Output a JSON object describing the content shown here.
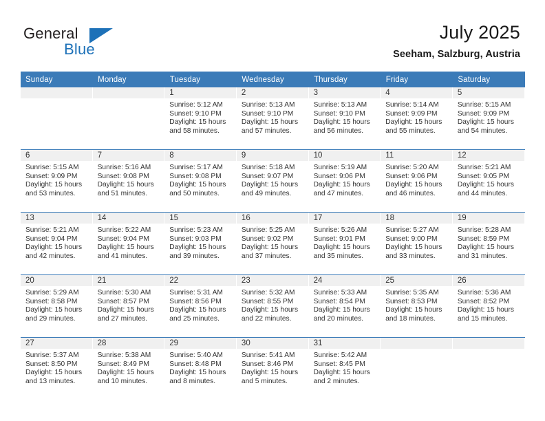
{
  "brand": {
    "name_top": "General",
    "name_bottom": "Blue",
    "triangle_color": "#1d71b8"
  },
  "header": {
    "title": "July 2025",
    "subtitle": "Seeham, Salzburg, Austria"
  },
  "theme": {
    "header_blue": "#3b7bb8",
    "band_gray": "#f0f0f0",
    "text": "#333333"
  },
  "weekday_headers": [
    "Sunday",
    "Monday",
    "Tuesday",
    "Wednesday",
    "Thursday",
    "Friday",
    "Saturday"
  ],
  "labels": {
    "sunrise_prefix": "Sunrise:",
    "sunset_prefix": "Sunset:",
    "daylight_prefix": "Daylight:"
  },
  "weeks": [
    [
      {
        "day": "",
        "blank": true
      },
      {
        "day": "",
        "blank": true
      },
      {
        "day": "1",
        "sunrise": "Sunrise: 5:12 AM",
        "sunset": "Sunset: 9:10 PM",
        "daylight1": "Daylight: 15 hours",
        "daylight2": "and 58 minutes."
      },
      {
        "day": "2",
        "sunrise": "Sunrise: 5:13 AM",
        "sunset": "Sunset: 9:10 PM",
        "daylight1": "Daylight: 15 hours",
        "daylight2": "and 57 minutes."
      },
      {
        "day": "3",
        "sunrise": "Sunrise: 5:13 AM",
        "sunset": "Sunset: 9:10 PM",
        "daylight1": "Daylight: 15 hours",
        "daylight2": "and 56 minutes."
      },
      {
        "day": "4",
        "sunrise": "Sunrise: 5:14 AM",
        "sunset": "Sunset: 9:09 PM",
        "daylight1": "Daylight: 15 hours",
        "daylight2": "and 55 minutes."
      },
      {
        "day": "5",
        "sunrise": "Sunrise: 5:15 AM",
        "sunset": "Sunset: 9:09 PM",
        "daylight1": "Daylight: 15 hours",
        "daylight2": "and 54 minutes."
      }
    ],
    [
      {
        "day": "6",
        "sunrise": "Sunrise: 5:15 AM",
        "sunset": "Sunset: 9:09 PM",
        "daylight1": "Daylight: 15 hours",
        "daylight2": "and 53 minutes."
      },
      {
        "day": "7",
        "sunrise": "Sunrise: 5:16 AM",
        "sunset": "Sunset: 9:08 PM",
        "daylight1": "Daylight: 15 hours",
        "daylight2": "and 51 minutes."
      },
      {
        "day": "8",
        "sunrise": "Sunrise: 5:17 AM",
        "sunset": "Sunset: 9:08 PM",
        "daylight1": "Daylight: 15 hours",
        "daylight2": "and 50 minutes."
      },
      {
        "day": "9",
        "sunrise": "Sunrise: 5:18 AM",
        "sunset": "Sunset: 9:07 PM",
        "daylight1": "Daylight: 15 hours",
        "daylight2": "and 49 minutes."
      },
      {
        "day": "10",
        "sunrise": "Sunrise: 5:19 AM",
        "sunset": "Sunset: 9:06 PM",
        "daylight1": "Daylight: 15 hours",
        "daylight2": "and 47 minutes."
      },
      {
        "day": "11",
        "sunrise": "Sunrise: 5:20 AM",
        "sunset": "Sunset: 9:06 PM",
        "daylight1": "Daylight: 15 hours",
        "daylight2": "and 46 minutes."
      },
      {
        "day": "12",
        "sunrise": "Sunrise: 5:21 AM",
        "sunset": "Sunset: 9:05 PM",
        "daylight1": "Daylight: 15 hours",
        "daylight2": "and 44 minutes."
      }
    ],
    [
      {
        "day": "13",
        "sunrise": "Sunrise: 5:21 AM",
        "sunset": "Sunset: 9:04 PM",
        "daylight1": "Daylight: 15 hours",
        "daylight2": "and 42 minutes."
      },
      {
        "day": "14",
        "sunrise": "Sunrise: 5:22 AM",
        "sunset": "Sunset: 9:04 PM",
        "daylight1": "Daylight: 15 hours",
        "daylight2": "and 41 minutes."
      },
      {
        "day": "15",
        "sunrise": "Sunrise: 5:23 AM",
        "sunset": "Sunset: 9:03 PM",
        "daylight1": "Daylight: 15 hours",
        "daylight2": "and 39 minutes."
      },
      {
        "day": "16",
        "sunrise": "Sunrise: 5:25 AM",
        "sunset": "Sunset: 9:02 PM",
        "daylight1": "Daylight: 15 hours",
        "daylight2": "and 37 minutes."
      },
      {
        "day": "17",
        "sunrise": "Sunrise: 5:26 AM",
        "sunset": "Sunset: 9:01 PM",
        "daylight1": "Daylight: 15 hours",
        "daylight2": "and 35 minutes."
      },
      {
        "day": "18",
        "sunrise": "Sunrise: 5:27 AM",
        "sunset": "Sunset: 9:00 PM",
        "daylight1": "Daylight: 15 hours",
        "daylight2": "and 33 minutes."
      },
      {
        "day": "19",
        "sunrise": "Sunrise: 5:28 AM",
        "sunset": "Sunset: 8:59 PM",
        "daylight1": "Daylight: 15 hours",
        "daylight2": "and 31 minutes."
      }
    ],
    [
      {
        "day": "20",
        "sunrise": "Sunrise: 5:29 AM",
        "sunset": "Sunset: 8:58 PM",
        "daylight1": "Daylight: 15 hours",
        "daylight2": "and 29 minutes."
      },
      {
        "day": "21",
        "sunrise": "Sunrise: 5:30 AM",
        "sunset": "Sunset: 8:57 PM",
        "daylight1": "Daylight: 15 hours",
        "daylight2": "and 27 minutes."
      },
      {
        "day": "22",
        "sunrise": "Sunrise: 5:31 AM",
        "sunset": "Sunset: 8:56 PM",
        "daylight1": "Daylight: 15 hours",
        "daylight2": "and 25 minutes."
      },
      {
        "day": "23",
        "sunrise": "Sunrise: 5:32 AM",
        "sunset": "Sunset: 8:55 PM",
        "daylight1": "Daylight: 15 hours",
        "daylight2": "and 22 minutes."
      },
      {
        "day": "24",
        "sunrise": "Sunrise: 5:33 AM",
        "sunset": "Sunset: 8:54 PM",
        "daylight1": "Daylight: 15 hours",
        "daylight2": "and 20 minutes."
      },
      {
        "day": "25",
        "sunrise": "Sunrise: 5:35 AM",
        "sunset": "Sunset: 8:53 PM",
        "daylight1": "Daylight: 15 hours",
        "daylight2": "and 18 minutes."
      },
      {
        "day": "26",
        "sunrise": "Sunrise: 5:36 AM",
        "sunset": "Sunset: 8:52 PM",
        "daylight1": "Daylight: 15 hours",
        "daylight2": "and 15 minutes."
      }
    ],
    [
      {
        "day": "27",
        "sunrise": "Sunrise: 5:37 AM",
        "sunset": "Sunset: 8:50 PM",
        "daylight1": "Daylight: 15 hours",
        "daylight2": "and 13 minutes."
      },
      {
        "day": "28",
        "sunrise": "Sunrise: 5:38 AM",
        "sunset": "Sunset: 8:49 PM",
        "daylight1": "Daylight: 15 hours",
        "daylight2": "and 10 minutes."
      },
      {
        "day": "29",
        "sunrise": "Sunrise: 5:40 AM",
        "sunset": "Sunset: 8:48 PM",
        "daylight1": "Daylight: 15 hours",
        "daylight2": "and 8 minutes."
      },
      {
        "day": "30",
        "sunrise": "Sunrise: 5:41 AM",
        "sunset": "Sunset: 8:46 PM",
        "daylight1": "Daylight: 15 hours",
        "daylight2": "and 5 minutes."
      },
      {
        "day": "31",
        "sunrise": "Sunrise: 5:42 AM",
        "sunset": "Sunset: 8:45 PM",
        "daylight1": "Daylight: 15 hours",
        "daylight2": "and 2 minutes."
      },
      {
        "day": "",
        "blank": true
      },
      {
        "day": "",
        "blank": true
      }
    ]
  ]
}
